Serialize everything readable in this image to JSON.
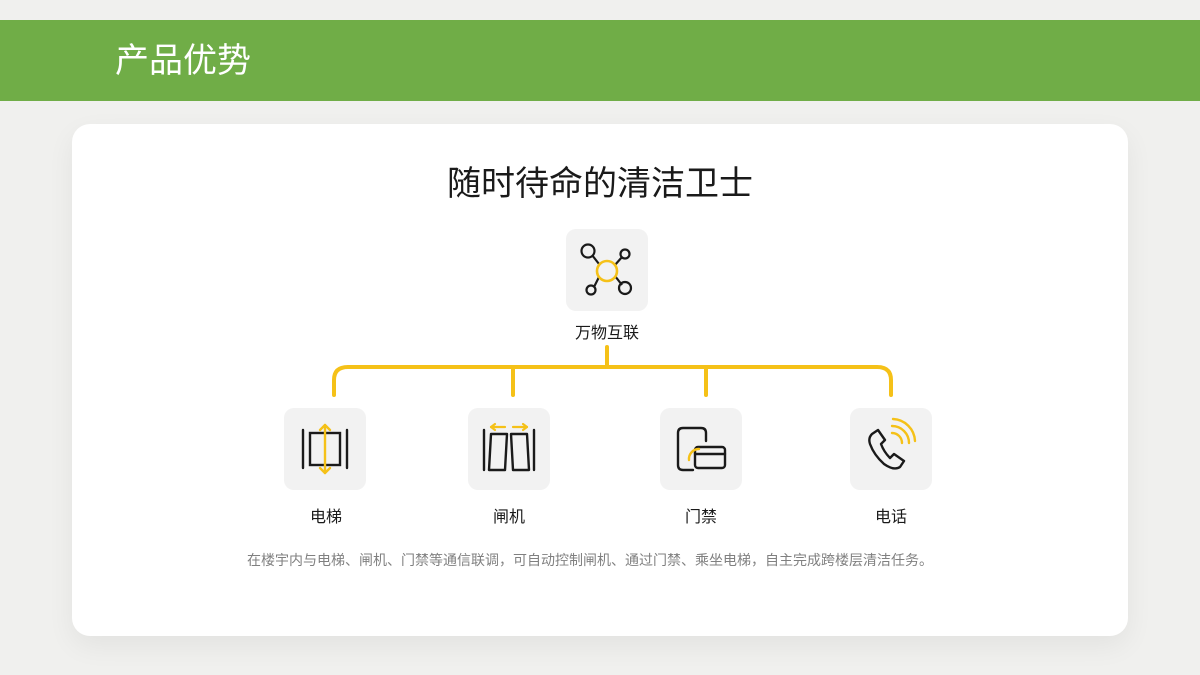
{
  "header": {
    "title": "产品优势"
  },
  "card": {
    "title": "随时待命的清洁卫士",
    "hub": {
      "label": "万物互联",
      "icon": "network-nodes-icon"
    },
    "nodes": [
      {
        "label": "电梯",
        "icon": "elevator-icon"
      },
      {
        "label": "闸机",
        "icon": "gate-turnstile-icon"
      },
      {
        "label": "门禁",
        "icon": "access-card-icon"
      },
      {
        "label": "电话",
        "icon": "phone-signal-icon"
      }
    ],
    "description": "在楼宇内与电梯、闸机、门禁等通信联调，可自动控制闸机、通过门禁、乘坐电梯，自主完成跨楼层清洁任务。"
  },
  "colors": {
    "header": "#70ad47",
    "accent": "#f5c118",
    "tile": "#f2f2f2",
    "text_dark": "#1a1a1a",
    "text_muted": "#808080"
  }
}
